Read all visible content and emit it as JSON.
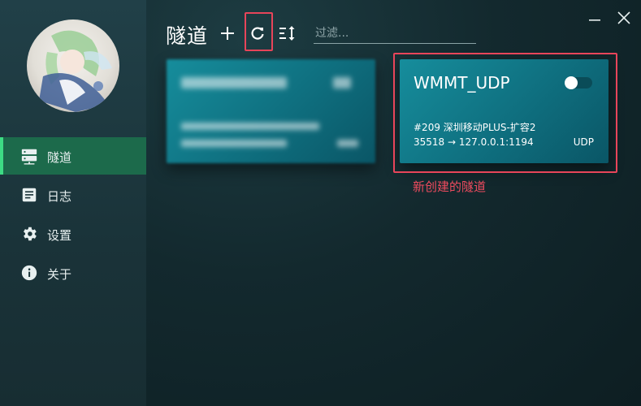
{
  "sidebar": {
    "items": [
      {
        "label": "隧道",
        "icon": "server-icon",
        "active": true
      },
      {
        "label": "日志",
        "icon": "document-icon",
        "active": false
      },
      {
        "label": "设置",
        "icon": "gear-icon",
        "active": false
      },
      {
        "label": "关于",
        "icon": "info-icon",
        "active": false
      }
    ]
  },
  "header": {
    "title": "隧道",
    "add_icon": "plus-icon",
    "refresh_icon": "refresh-icon",
    "sort_icon": "sort-icon",
    "filter_placeholder": "过滤...",
    "filter_value": ""
  },
  "window": {
    "minimize_icon": "minimize-icon",
    "close_icon": "close-icon"
  },
  "cards": {
    "new_tunnel": {
      "name": "WMMT_UDP",
      "server": "#209 深圳移动PLUS-扩容2",
      "route": "35518 → 127.0.0.1:1194",
      "protocol": "UDP",
      "enabled": false
    }
  },
  "annotation": {
    "text": "新创建的隧道"
  },
  "colors": {
    "accent_active": "#1c6a4b",
    "card": "#117f8f",
    "highlight": "#e8455a"
  }
}
